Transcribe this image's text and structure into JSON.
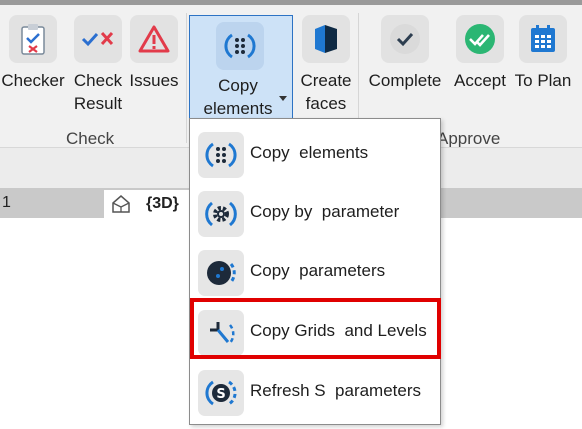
{
  "ribbon": {
    "check_group": {
      "label": "Check",
      "buttons": [
        {
          "label": "Checker",
          "icon": "clipboard-check-icon"
        },
        {
          "label": "Check\nResult",
          "icon": "check-result-icon"
        },
        {
          "label": "Issues",
          "icon": "warning-icon"
        }
      ]
    },
    "copy_button": {
      "label": "Copy\nelements",
      "icon": "copy-elements-icon"
    },
    "create_faces": {
      "label": "Create\nfaces",
      "icon": "faces-icon"
    },
    "approve_group": {
      "label": "Approve",
      "buttons": [
        {
          "label": "Complete",
          "icon": "checkmark-circle-icon"
        },
        {
          "label": "Accept",
          "icon": "double-check-icon"
        },
        {
          "label": "To Plan",
          "icon": "calendar-icon"
        }
      ]
    }
  },
  "view_tabs": {
    "number": "1",
    "active_tab": "{3D}"
  },
  "dropdown": {
    "items": [
      {
        "label": "Copy  elements",
        "icon": "copy-elements-icon"
      },
      {
        "label": "Copy by  parameter",
        "icon": "gear-icon"
      },
      {
        "label": "Copy  parameters",
        "icon": "parameters-icon"
      },
      {
        "label": "Copy Grids  and Levels",
        "icon": "grids-levels-icon",
        "highlighted": true
      },
      {
        "label": "Refresh S  parameters",
        "icon": "refresh-s-icon"
      }
    ]
  },
  "colors": {
    "accent": "#2d73c4",
    "highlight": "#e00000",
    "pressed": "#cde2f7"
  }
}
